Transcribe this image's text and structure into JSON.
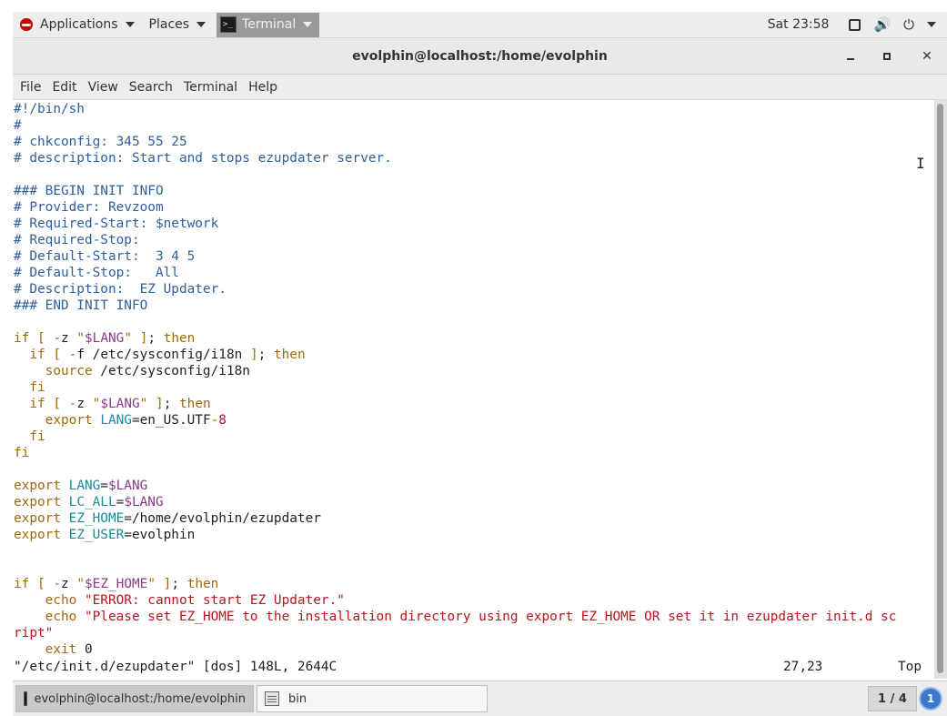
{
  "topbar": {
    "applications": "Applications",
    "places": "Places",
    "terminal": "Terminal",
    "clock": "Sat 23:58",
    "icons": [
      "screen-icon",
      "volume-icon",
      "power-icon",
      "chevron-down-icon"
    ]
  },
  "window": {
    "title": "evolphin@localhost:/home/evolphin",
    "minimize": "–",
    "maximize": "□",
    "close": "✕"
  },
  "menu": [
    "File",
    "Edit",
    "View",
    "Search",
    "Terminal",
    "Help"
  ],
  "editor": {
    "lines": [
      "#!/bin/sh",
      "#",
      "# chkconfig: 345 55 25",
      "# description: Start and stops ezupdater server.",
      "",
      "### BEGIN INIT INFO",
      "# Provider: Revzoom",
      "# Required-Start: $network",
      "# Required-Stop:",
      "# Default-Start:  3 4 5",
      "# Default-Stop:   All",
      "# Description:  EZ Updater.",
      "### END INIT INFO",
      "",
      "if [ -z \"$LANG\" ]; then",
      "  if [ -f /etc/sysconfig/i18n ]; then",
      "    source /etc/sysconfig/i18n",
      "  fi",
      "  if [ -z \"$LANG\" ]; then",
      "    export LANG=en_US.UTF-8",
      "  fi",
      "fi",
      "",
      "export LANG=$LANG",
      "export LC_ALL=$LANG",
      "export EZ_HOME=/home/evolphin/ezupdater",
      "export EZ_USER=evolphin",
      "",
      "",
      "if [ -z \"$EZ_HOME\" ]; then",
      "    echo \"ERROR: cannot start EZ Updater.\"",
      "    echo \"Please set EZ_HOME to the installation directory using export EZ_HOME OR set it in ezupdater init.d sc",
      "ript\"",
      "    exit 0"
    ],
    "status_file": "\"/etc/init.d/ezupdater\" [dos] 148L, 2644C",
    "status_pos": "27,23",
    "status_top": "Top"
  },
  "taskbar": {
    "task1": "evolphin@localhost:/home/evolphin",
    "task2": "bin",
    "workspace": "1 / 4",
    "notifications": "1"
  },
  "colors": {
    "comment": "#2f5f9a",
    "keyword": "#a0690a",
    "variable": "#8b3a8b",
    "string": "#b8161e",
    "identifier": "#1b8a9a"
  }
}
